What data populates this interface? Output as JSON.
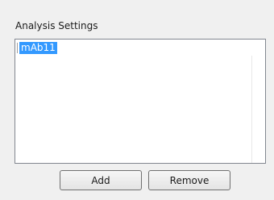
{
  "analysis_settings": {
    "title": "Analysis Settings",
    "list_items": [
      {
        "label": "mAb11",
        "selected": true
      }
    ],
    "add_label": "Add",
    "remove_label": "Remove"
  },
  "colors": {
    "selection_bg": "#3399ff",
    "selection_text": "#ffffff",
    "window_bg": "#f0f0f0",
    "list_bg": "#ffffff"
  }
}
